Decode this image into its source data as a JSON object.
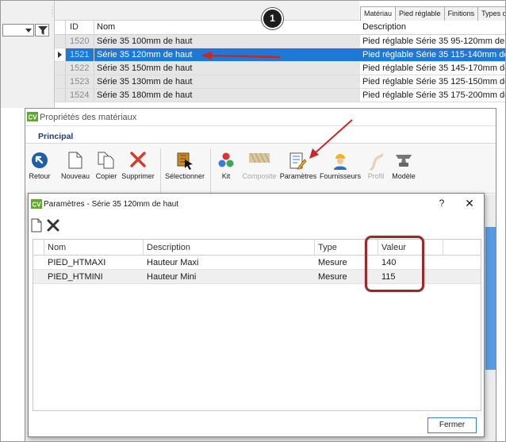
{
  "background_app": {
    "grid": {
      "header": {
        "id": "ID",
        "nom": "Nom"
      },
      "rows": [
        {
          "id": "1520",
          "nom": "Série 35 100mm de haut"
        },
        {
          "id": "1521",
          "nom": "Série 35 120mm de haut"
        },
        {
          "id": "1522",
          "nom": "Série 35 150mm de haut"
        },
        {
          "id": "1523",
          "nom": "Série 35 130mm de haut"
        },
        {
          "id": "1524",
          "nom": "Série 35 180mm de haut"
        }
      ],
      "selected_index": 1
    },
    "tabs": [
      "Matériau",
      "Pied réglable",
      "Finitions",
      "Types d"
    ],
    "description": {
      "header": "Description",
      "rows": [
        "Pied réglable Série 35  95-120mm de h",
        "Pied réglable Série 35  115-140mm de",
        "Pied réglable Série 35  145-170mm de",
        "Pied réglable Série 35  125-150mm de",
        "Pied réglable Série 35  175-200mm de"
      ]
    },
    "step_badge": "1"
  },
  "properties_window": {
    "title": "Propriétés des matériaux",
    "app_icon": "CV",
    "ribbon_tab": "Principal",
    "ribbon_buttons": [
      {
        "label": "Retour",
        "icon": "back-arrow-icon"
      },
      {
        "label": "Nouveau",
        "icon": "new-document-icon"
      },
      {
        "label": "Copier",
        "icon": "copy-icon"
      },
      {
        "label": "Supprimer",
        "icon": "delete-x-icon"
      },
      {
        "label": "Sélectionner",
        "icon": "select-cursor-icon"
      },
      {
        "label": "Kit",
        "icon": "kit-icon"
      },
      {
        "label": "Composite",
        "icon": "composite-icon"
      },
      {
        "label": "Paramètres",
        "icon": "parameters-icon"
      },
      {
        "label": "Fournisseurs",
        "icon": "supplier-icon"
      },
      {
        "label": "Profil",
        "icon": "profile-icon"
      },
      {
        "label": "Modèle",
        "icon": "anvil-icon"
      }
    ]
  },
  "parameters_dialog": {
    "title": "Paramètres - Série 35 120mm de haut",
    "app_icon": "CV",
    "help": "?",
    "close": "✕",
    "columns": [
      "Nom",
      "Description",
      "Type",
      "Valeur"
    ],
    "rows": [
      {
        "nom": "PIED_HTMAXI",
        "description": "Hauteur Maxi",
        "type": "Mesure",
        "valeur": "140"
      },
      {
        "nom": "PIED_HTMINI",
        "description": "Hauteur Mini",
        "type": "Mesure",
        "valeur": "115"
      }
    ],
    "close_button": "Fermer"
  },
  "colors": {
    "selection": "#1e78d6",
    "annotation_red": "#c62828",
    "ribbon_tab": "#1d3c74",
    "badge": "#1d1d1d"
  }
}
